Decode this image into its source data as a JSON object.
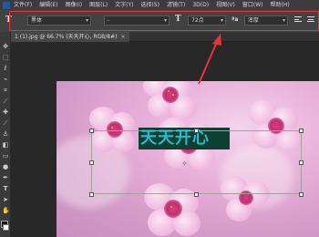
{
  "menubar": {
    "items": [
      "文件(F)",
      "编辑(E)",
      "图像(I)",
      "图层(L)",
      "文字(Y)",
      "选择(S)",
      "滤镜(T)",
      "3D(D)",
      "视图(V)",
      "窗口(W)",
      "帮助(H)"
    ]
  },
  "options": {
    "font_family": "黑体",
    "font_style": "-",
    "font_size": "72点",
    "anti_alias": "浑厚",
    "aa_label": "ªa",
    "size_icon": "T",
    "tool_icon": "T"
  },
  "document": {
    "tab_title": "1 (1).jpg @ 66.7% (天天开心, RGB/8#)",
    "close_label": "×"
  },
  "text_layer": {
    "content": "天天开心",
    "color": "#2db9c8",
    "background": "#0e3f33"
  },
  "colors": {
    "annotation": "#e8333a",
    "ui_dark": "#2b2b2b",
    "options_bar": "#424242"
  },
  "icons": {
    "tools": [
      "move-icon",
      "marquee-icon",
      "lasso-icon",
      "quick-select-icon",
      "crop-icon",
      "eyedropper-icon",
      "healing-icon",
      "brush-icon",
      "stamp-icon",
      "history-brush-icon",
      "eraser-icon",
      "gradient-icon",
      "blur-icon",
      "dodge-icon",
      "pen-icon",
      "type-icon",
      "path-select-icon",
      "shape-icon",
      "hand-icon",
      "zoom-icon"
    ]
  }
}
